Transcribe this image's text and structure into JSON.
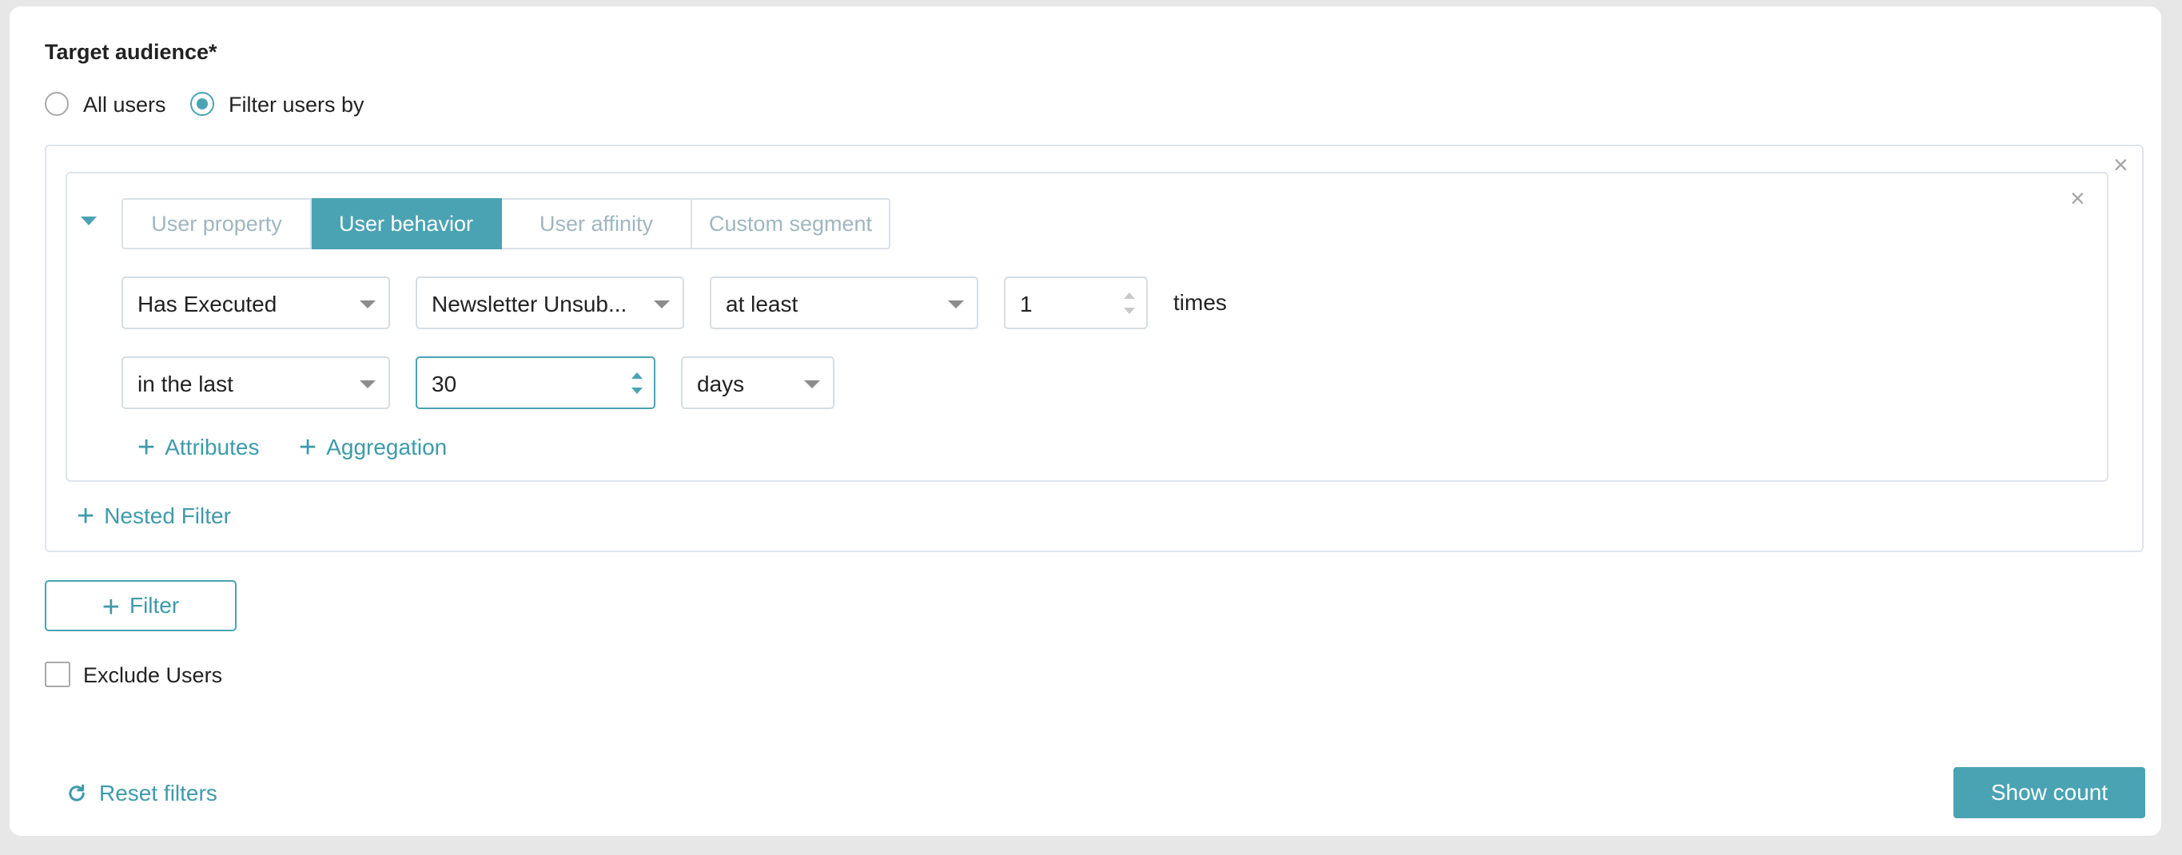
{
  "section": {
    "title": "Target audience*"
  },
  "audience": {
    "options": [
      {
        "label": "All users",
        "selected": false
      },
      {
        "label": "Filter users by",
        "selected": true
      }
    ]
  },
  "filter": {
    "tabs": [
      "User property",
      "User behavior",
      "User affinity",
      "Custom segment"
    ],
    "active_tab": "User behavior",
    "row1": {
      "action": "Has Executed",
      "event": "Newsletter Unsub...",
      "comparator": "at least",
      "count": "1",
      "count_suffix": "times"
    },
    "row2": {
      "time_range": "in the last",
      "duration": "30",
      "unit": "days"
    },
    "add_attributes": "Attributes",
    "add_aggregation": "Aggregation"
  },
  "nested_filter": "Nested Filter",
  "add_filter": "Filter",
  "exclude_users": {
    "label": "Exclude Users",
    "checked": false
  },
  "footer": {
    "reset": "Reset filters",
    "show_count": "Show count"
  },
  "colors": {
    "accent": "#4aa3b3",
    "border": "#dde5ec"
  },
  "icons": [
    "close-icon",
    "chevron-down-icon",
    "plus-icon",
    "refresh-icon"
  ]
}
